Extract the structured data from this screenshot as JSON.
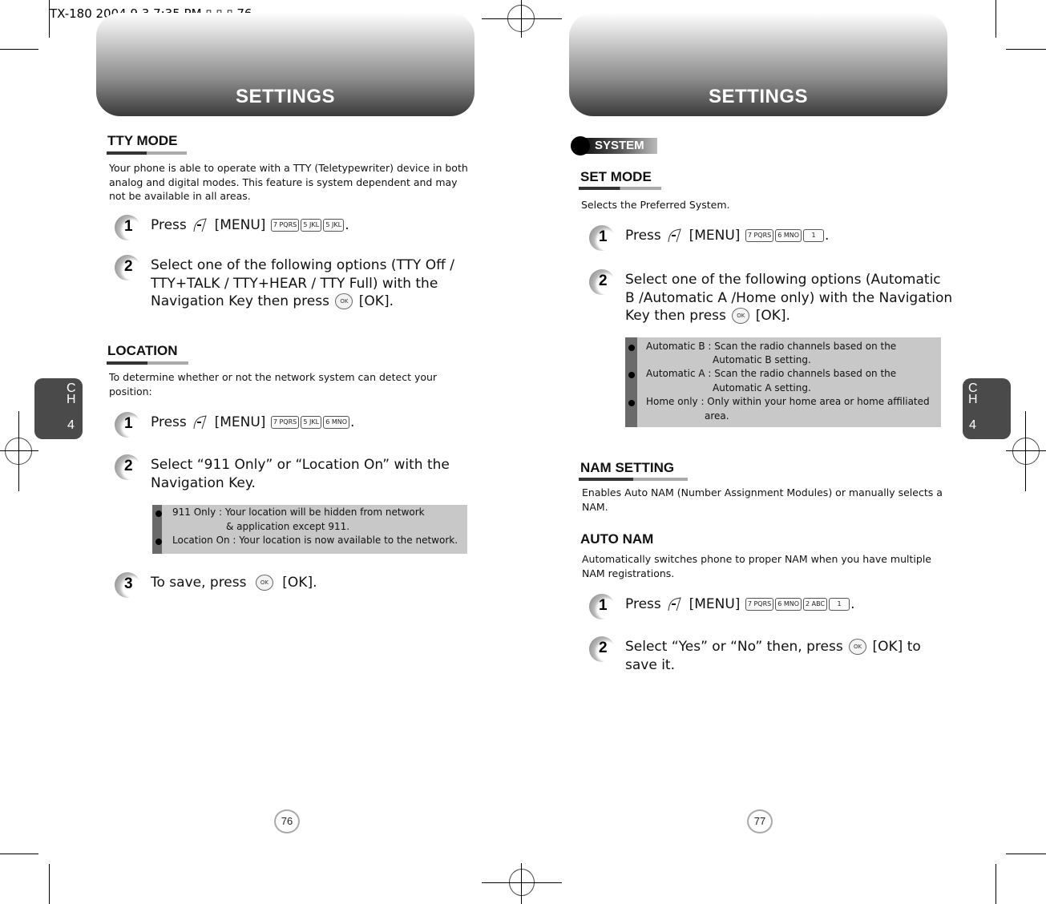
{
  "slug": "TX-180  2004.9.3 7:35 PM ▯ ▯ ▯ 76",
  "left_page": {
    "header_title": "SETTINGS",
    "chapter_tab": {
      "letters": "C\nH",
      "number": "4"
    },
    "page_number": "76",
    "tty_mode": {
      "heading": "TTY MODE",
      "description": "Your phone is able to operate with a TTY (Teletypewriter) device in both analog and digital modes. This feature is system dependent and may not be available in all areas.",
      "steps": [
        {
          "num": "1",
          "text_before": "Press",
          "softkey": "soft-key-icon",
          "menu_label": "[MENU]",
          "keys": [
            "7 PQRS",
            "5 JKL",
            "5 JKL"
          ],
          "text_after": "."
        },
        {
          "num": "2",
          "text": "Select one of the following options (TTY Off / TTY+TALK / TTY+HEAR / TTY Full) with the Navigation Key then press",
          "ok_key": "OK",
          "ok_label": "[OK]."
        }
      ]
    },
    "location": {
      "heading": "LOCATION",
      "description": "To determine whether or not the network system can detect your position:",
      "steps": [
        {
          "num": "1",
          "text_before": "Press",
          "menu_label": "[MENU]",
          "keys": [
            "7 PQRS",
            "5 JKL",
            "6 MNO"
          ],
          "text_after": "."
        },
        {
          "num": "2",
          "text": "Select “911 Only” or “Location On” with the Navigation Key."
        },
        {
          "num": "3",
          "text_before": "To save, press",
          "ok_key": "OK",
          "ok_label": "[OK]."
        }
      ],
      "notes": [
        {
          "line1": "911 Only : Your location will be hidden from network",
          "line2": "& application except 911."
        },
        {
          "line1": "Location On : Your location is now available to the network."
        }
      ]
    }
  },
  "right_page": {
    "header_title": "SETTINGS",
    "chapter_tab": {
      "letters": "C\nH",
      "number": "4"
    },
    "page_number": "77",
    "badge": "SYSTEM",
    "set_mode": {
      "heading": "SET MODE",
      "description": "Selects the Preferred System.",
      "steps": [
        {
          "num": "1",
          "text_before": "Press",
          "menu_label": "[MENU]",
          "keys": [
            "7 PQRS",
            "6 MNO",
            "1"
          ],
          "text_after": "."
        },
        {
          "num": "2",
          "text": "Select one of the following options (Automatic B /Automatic A /Home only) with the Navigation Key then press",
          "ok_key": "OK",
          "ok_label": "[OK]."
        }
      ],
      "notes": [
        {
          "line1": "Automatic B : Scan the radio channels based on the",
          "line2": "Automatic B setting."
        },
        {
          "line1": "Automatic A : Scan the radio channels based on the",
          "line2": "Automatic A setting."
        },
        {
          "line1": "Home only : Only within your home area or home affiliated",
          "line2": "area."
        }
      ]
    },
    "nam_setting": {
      "heading": "NAM SETTING",
      "description": "Enables Auto NAM (Number Assignment Modules) or manually selects a NAM."
    },
    "auto_nam": {
      "heading": "AUTO NAM",
      "description": "Automatically switches phone to proper NAM when you have multiple NAM registrations.",
      "steps": [
        {
          "num": "1",
          "text_before": "Press",
          "menu_label": "[MENU]",
          "keys": [
            "7 PQRS",
            "6 MNO",
            "2 ABC",
            "1"
          ],
          "text_after": "."
        },
        {
          "num": "2",
          "text_before": "Select “Yes” or “No” then, press",
          "ok_key": "OK",
          "ok_label": "[OK] to",
          "text_line2": "save it."
        }
      ]
    }
  }
}
